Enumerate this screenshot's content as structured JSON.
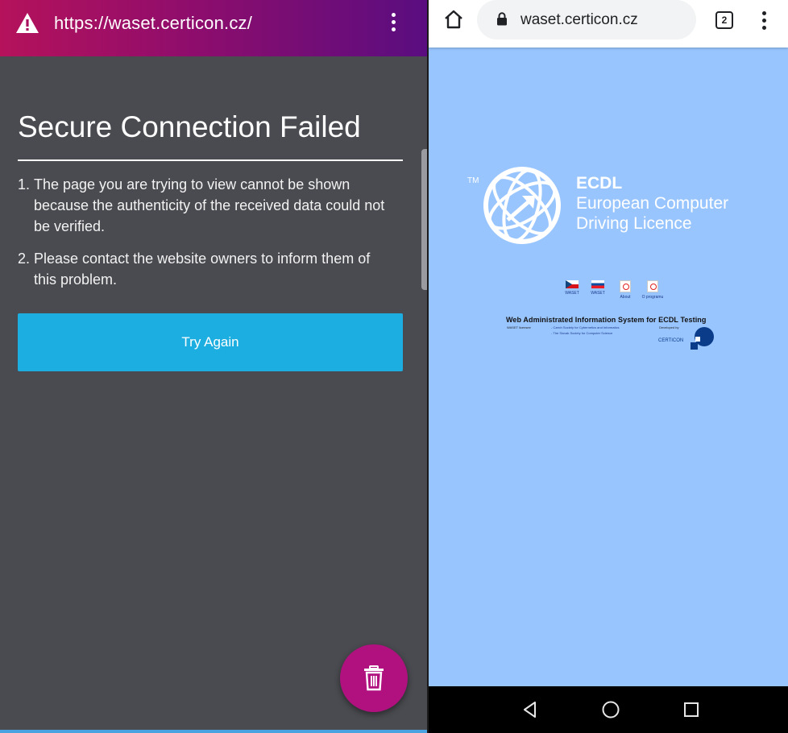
{
  "left_browser": {
    "url": "https://waset.certicon.cz/",
    "warning_icon": "warning-triangle-icon",
    "menu_icon": "kebab-menu-icon",
    "colors": {
      "toolbar_gradient": [
        "#b5125b",
        "#5a0d80"
      ],
      "background": "#4a4b50",
      "button": "#1caee0",
      "fab": "#b0117f"
    }
  },
  "error_page": {
    "title": "Secure Connection Failed",
    "items": [
      {
        "num": "1.",
        "text": "The page you are trying to view cannot be shown because the authenticity of the received data could not be verified."
      },
      {
        "num": "2.",
        "text": "Please contact the website owners to inform them of this problem."
      }
    ],
    "button_label": "Try Again",
    "fab_icon": "trash-icon"
  },
  "right_browser": {
    "url": "waset.certicon.cz",
    "tab_count": "2",
    "home_icon": "home-icon",
    "lock_icon": "lock-icon",
    "menu_icon": "kebab-menu-icon",
    "background": "#99c5ff"
  },
  "ecdl_page": {
    "tm": "TM",
    "logo_icon": "ecdl-globe-icon",
    "brand": "ECDL",
    "line2": "European Computer",
    "line3": "Driving Licence",
    "links": [
      {
        "icon": "flag-cz-icon",
        "caption": "WASET"
      },
      {
        "icon": "flag-sk-icon",
        "caption": "WASET"
      },
      {
        "icon": "pdf-icon",
        "caption": "About"
      },
      {
        "icon": "pdf-icon",
        "caption": "O programu"
      }
    ],
    "system_title": "Web Administrated Information System for ECDL Testing",
    "licensee": "WASET licensee",
    "society1": "- Czech Society for Cybernetics and Informatics",
    "society2": "- The Slovak Society for Computer Science",
    "developed_by": "Developed by",
    "developer_logo": "CERTICON"
  },
  "android_nav": {
    "back_icon": "back-triangle-icon",
    "home_icon": "home-circle-icon",
    "recents_icon": "recents-square-icon"
  }
}
